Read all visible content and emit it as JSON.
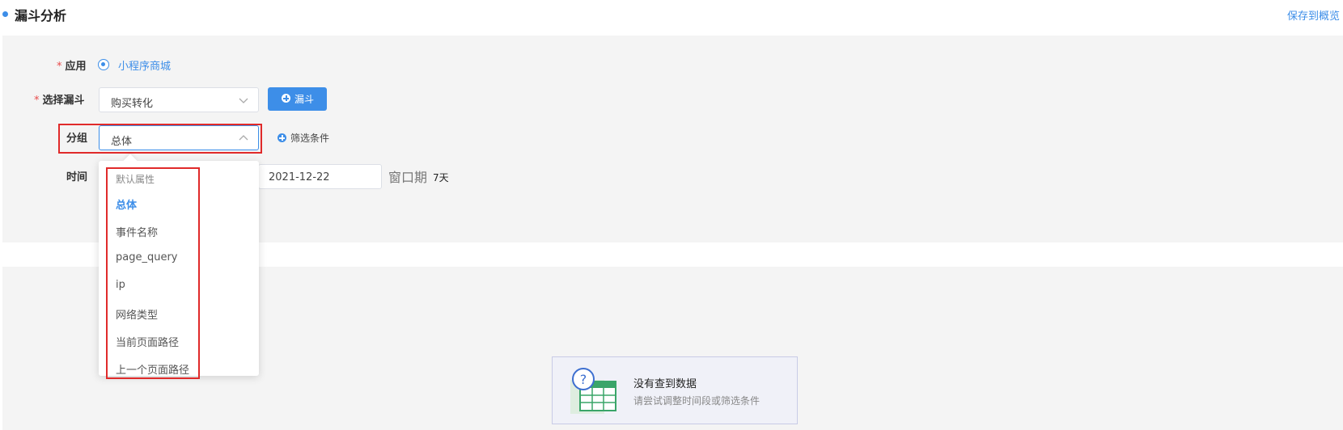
{
  "header": {
    "title": "漏斗分析",
    "save_link": "保存到概览"
  },
  "form": {
    "app_label": "应用",
    "app_value": "小程序商城",
    "funnel_label": "选择漏斗",
    "funnel_value": "购买转化",
    "funnel_button": "漏斗",
    "group_label": "分组",
    "group_value": "总体",
    "filter_label": "筛选条件",
    "time_label": "时间",
    "date_value": "2021-12-22",
    "window_label": "窗口期",
    "window_value": "7天",
    "required_mark": "*"
  },
  "dropdown": {
    "group_title": "默认属性",
    "options": [
      "总体",
      "事件名称",
      "page_query",
      "ip",
      "网络类型",
      "当前页面路径",
      "上一个页面路径"
    ],
    "selected": "总体"
  },
  "empty_state": {
    "title": "没有查到数据",
    "hint": "请尝试调整时间段或筛选条件"
  },
  "colors": {
    "accent": "#3d8ee8",
    "highlight": "#e02a2a",
    "required": "#e84b4b",
    "panel_bg": "#f4f4f4"
  },
  "icons": [
    "chevron-down-icon",
    "chevron-up-icon",
    "plus-circle-icon",
    "radio-icon",
    "no-data-illustration"
  ]
}
